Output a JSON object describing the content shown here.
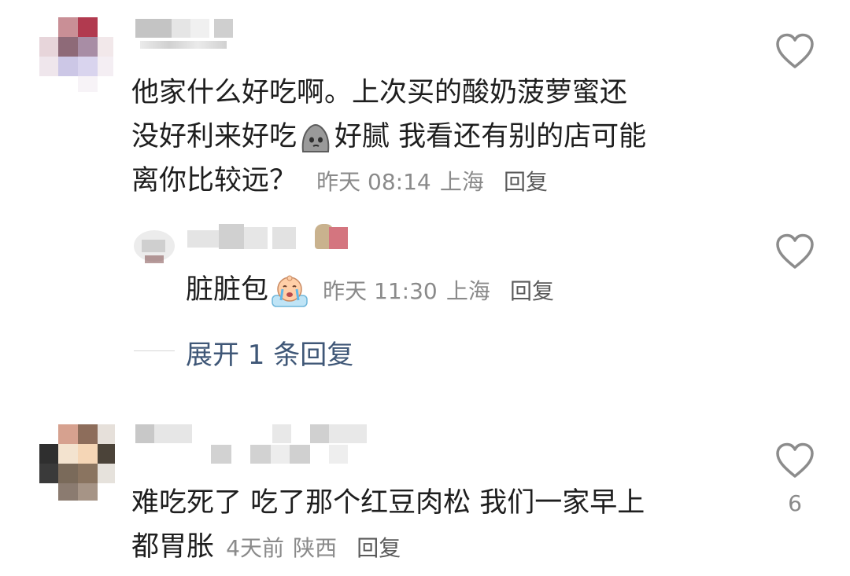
{
  "comments": [
    {
      "line1": "他家什么好吃啊。上次买的酸奶菠萝蜜还",
      "line2_a": "没好利来好吃",
      "line2_b": "好腻 我看还有别的店可能",
      "line3": "离你比较远？",
      "time": "昨天 08:14",
      "location": "上海",
      "reply_label": "回复",
      "emoji_icon": "pensive-blob-emoji"
    },
    {
      "line1": "难吃死了 吃了那个红豆肉松 我们一家早上",
      "line2": "都胃胀",
      "time": "4天前",
      "location": "陕西",
      "reply_label": "回复",
      "likes": "6"
    }
  ],
  "reply": {
    "text": "脏脏包",
    "time": "昨天 11:30",
    "location": "上海",
    "reply_label": "回复",
    "emoji_icon": "crying-baby-emoji"
  },
  "expand_replies": "展开 1 条回复",
  "colors": {
    "link": "#3f5777",
    "meta": "#8a8a8a",
    "text": "#1e1e1e",
    "heart_stroke": "#8c8c8c"
  }
}
